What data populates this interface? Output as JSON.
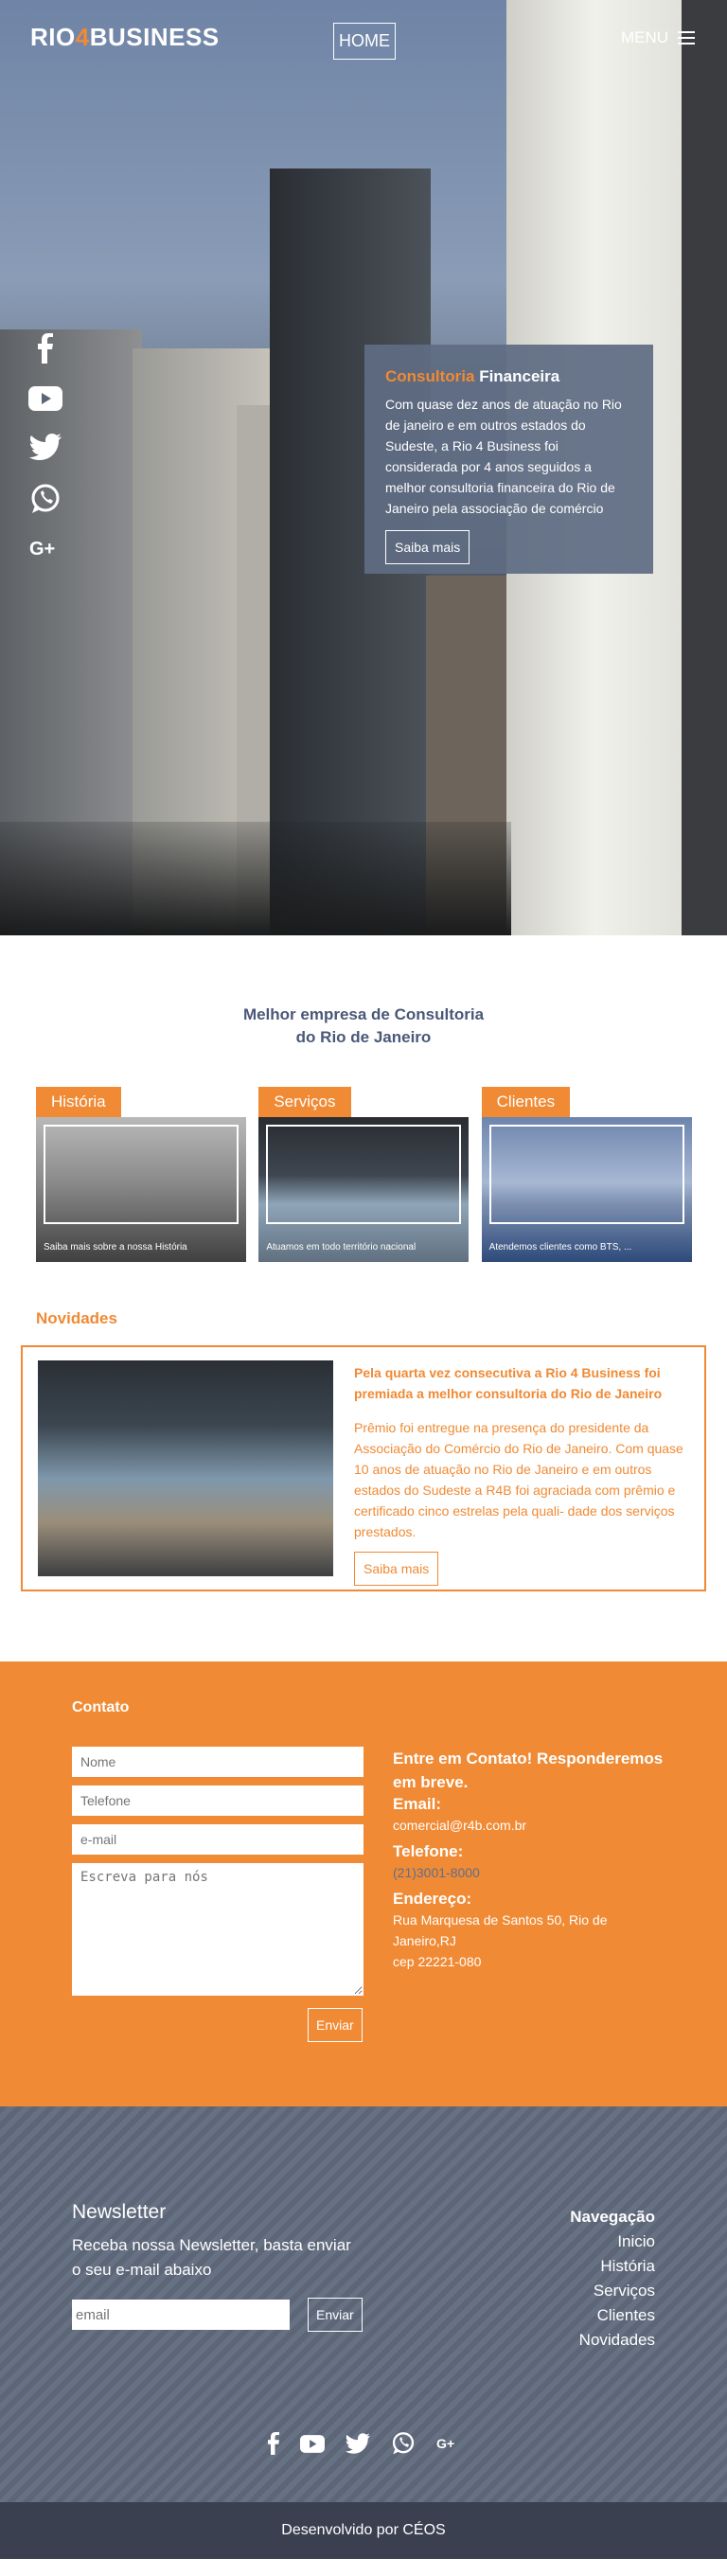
{
  "header": {
    "logo": {
      "part1": "RIO",
      "part2": "4",
      "part3": "BUSINESS"
    },
    "home_label": "HOME",
    "menu_label": "MENU"
  },
  "social_icons": [
    "facebook-icon",
    "youtube-icon",
    "twitter-icon",
    "whatsapp-icon",
    "google-plus-icon"
  ],
  "hero": {
    "title_accent": "Consultoria",
    "title_rest": "Financeira",
    "text": "Com quase dez anos de atuação no Rio de janeiro e em outros estados do Sudeste, a Rio 4 Business foi considerada por 4 anos seguidos a melhor consultoria financeira do Rio de Janeiro pela associação de comércio",
    "button": "Saiba mais"
  },
  "intro": {
    "line1": "Melhor empresa de Consultoria",
    "line2": "do Rio de Janeiro"
  },
  "cards": [
    {
      "tab": "História",
      "caption": "Saiba mais sobre a nossa História"
    },
    {
      "tab": "Serviços",
      "caption": "Atuamos em todo território nacional"
    },
    {
      "tab": "Clientes",
      "caption": "Atendemos clientes como BTS, ..."
    }
  ],
  "news": {
    "section_title": "Novidades",
    "headline": "Pela quarta vez consecutiva a Rio 4 Business foi premiada a melhor consultoria do Rio de Janeiro",
    "body": "Prêmio foi entregue na presença do presidente da Associação do Comércio do Rio de Janeiro. Com quase 10 anos de atuação no Rio de Janeiro e em outros estados do Sudeste a R4B foi agraciada com prêmio e certificado cinco estrelas pela quali- dade dos serviços prestados.",
    "button": "Saiba mais"
  },
  "contact": {
    "label": "Contato",
    "placeholders": {
      "name": "Nome",
      "phone": "Telefone",
      "email": "e-mail",
      "message": "Escreva para nós"
    },
    "send": "Enviar",
    "cta": "Entre em Contato! Responderemos em breve.",
    "email_label": "Email:",
    "email_value": "comercial@r4b.com.br",
    "phone_label": "Telefone:",
    "phone_value": "(21)3001-8000",
    "address_label": "Endereço:",
    "address_line1": "Rua Marquesa de Santos 50, Rio de Janeiro,RJ",
    "address_line2": "cep 22221-080"
  },
  "newsletter": {
    "title": "Newsletter",
    "text": "Receba nossa Newsletter, basta enviar o seu e-mail abaixo",
    "placeholder": "email",
    "button": "Enviar"
  },
  "nav": {
    "heading": "Navegação",
    "items": [
      "Inicio",
      "História",
      "Serviços",
      "Clientes",
      "Novidades"
    ]
  },
  "credits": "Desenvolvido por CÉOS",
  "colors": {
    "accent": "#f08a34",
    "slate": "#5d6677",
    "dark": "#3a4050"
  }
}
